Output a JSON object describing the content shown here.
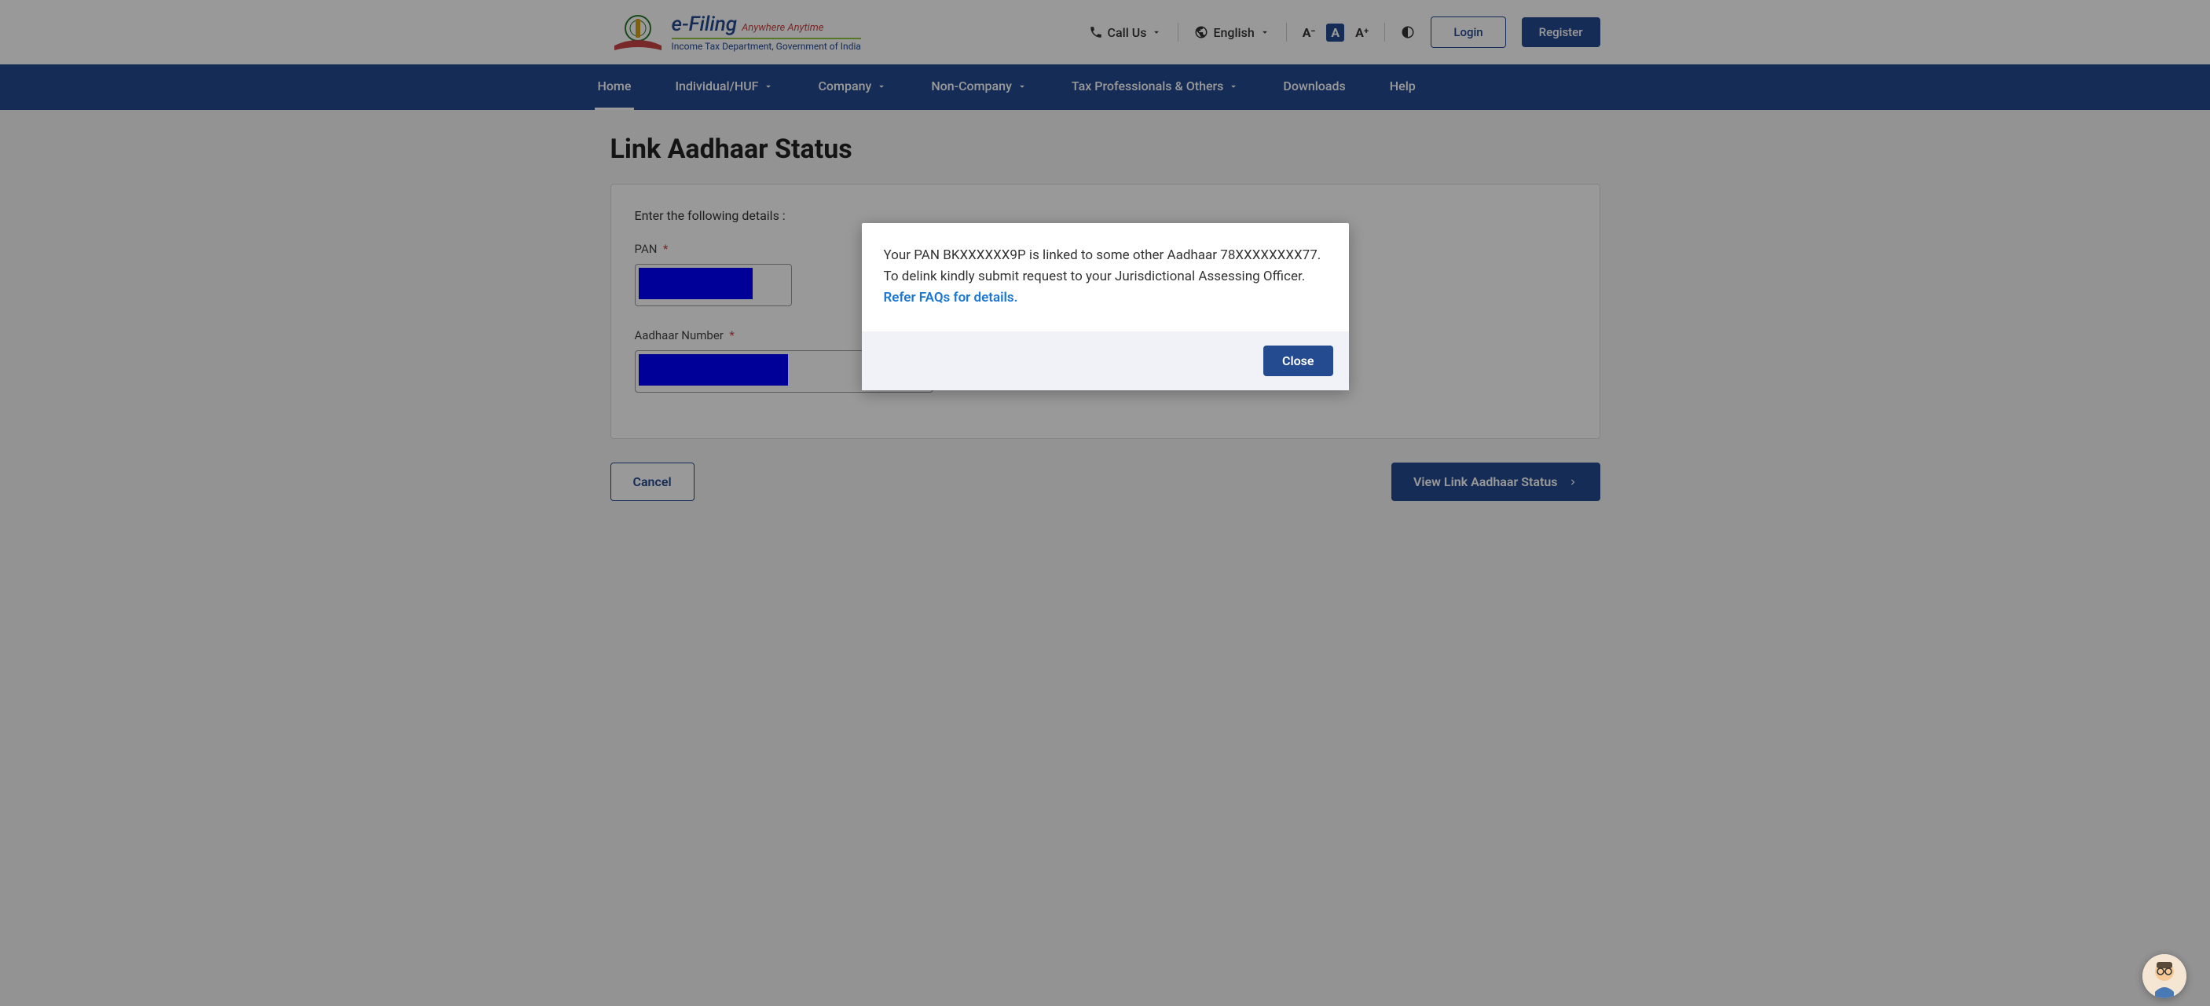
{
  "header": {
    "brand_title": "e-Filing",
    "brand_tagline": "Anywhere Anytime",
    "department": "Income Tax Department, Government of India",
    "call_us": "Call Us",
    "language": "English",
    "login": "Login",
    "register": "Register",
    "font_decrease": "A⁻",
    "font_normal": "A",
    "font_increase": "A⁺"
  },
  "nav": {
    "home": "Home",
    "individual": "Individual/HUF",
    "company": "Company",
    "non_company": "Non-Company",
    "tax_prof": "Tax Professionals & Others",
    "downloads": "Downloads",
    "help": "Help"
  },
  "page": {
    "title": "Link Aadhaar Status",
    "intro": "Enter the following details :",
    "pan_label": "PAN",
    "aadhaar_label": "Aadhaar Number",
    "required_mark": "*",
    "cancel": "Cancel",
    "submit": "View Link Aadhaar Status"
  },
  "modal": {
    "message": "Your PAN BKXXXXXX9P is linked to some other Aadhaar 78XXXXXXXX77. To delink kindly submit request to your Jurisdictional Assessing Officer. ",
    "link_text": "Refer FAQs for details.",
    "close": "Close"
  }
}
